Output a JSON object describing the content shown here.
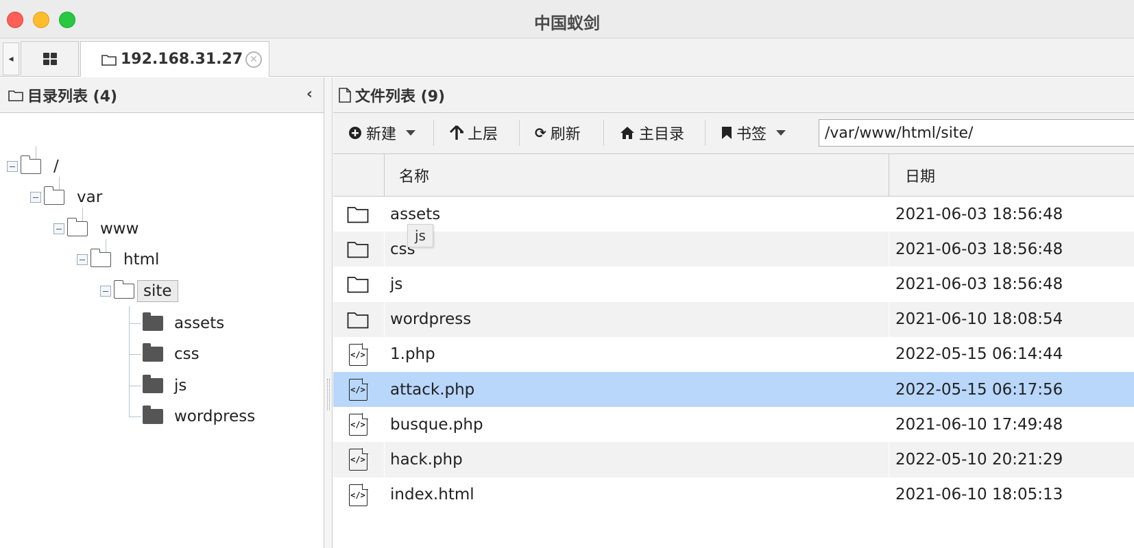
{
  "window": {
    "title": "中国蚁剑"
  },
  "tabs": {
    "host_label": "192.168.31.27"
  },
  "left_panel": {
    "title": "目录列表 (4)",
    "tree": [
      {
        "label": "/"
      },
      {
        "label": "var"
      },
      {
        "label": "www"
      },
      {
        "label": "html"
      },
      {
        "label": "site"
      },
      {
        "label": "assets"
      },
      {
        "label": "css"
      },
      {
        "label": "js"
      },
      {
        "label": "wordpress"
      }
    ]
  },
  "right_panel": {
    "title": "文件列表 (9)",
    "toolbar": {
      "new_label": "新建",
      "up_label": "上层",
      "refresh_label": "刷新",
      "home_label": "主目录",
      "bookmark_label": "书签",
      "path_value": "/var/www/html/site/"
    },
    "columns": {
      "name": "名称",
      "date": "日期"
    },
    "rows": [
      {
        "type": "folder",
        "name": "assets",
        "date": "2021-06-03 18:56:48"
      },
      {
        "type": "folder",
        "name": "css",
        "date": "2021-06-03 18:56:48"
      },
      {
        "type": "folder",
        "name": "js",
        "date": "2021-06-03 18:56:48"
      },
      {
        "type": "folder",
        "name": "wordpress",
        "date": "2021-06-10 18:08:54"
      },
      {
        "type": "file",
        "name": "1.php",
        "date": "2022-05-15 06:14:44"
      },
      {
        "type": "file",
        "name": "attack.php",
        "date": "2022-05-15 06:17:56"
      },
      {
        "type": "file",
        "name": "busque.php",
        "date": "2021-06-10 17:49:48"
      },
      {
        "type": "file",
        "name": "hack.php",
        "date": "2022-05-10 20:21:29"
      },
      {
        "type": "file",
        "name": "index.html",
        "date": "2021-06-10 18:05:13"
      }
    ],
    "selected_row": "attack.php",
    "tooltip": "js"
  },
  "colors": {
    "selection": "#b9d7fb",
    "close": "#fe5f57",
    "minimize": "#febc2e",
    "maximize": "#28c840"
  }
}
